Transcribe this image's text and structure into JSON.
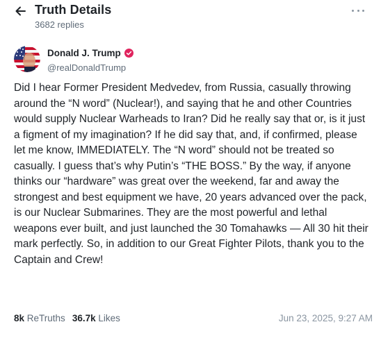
{
  "header": {
    "title": "Truth Details",
    "replies": "3682 replies"
  },
  "author": {
    "name": "Donald J. Trump",
    "handle": "@realDonaldTrump",
    "verified": true
  },
  "post": {
    "text": "Did I hear Former President Medvedev, from Russia, casually throwing around the “N word” (Nuclear!), and saying that he and other Countries would supply Nuclear Warheads to Iran? Did he really say that or, is it just a figment of my imagination? If he did say that, and, if confirmed, please let me know, IMMEDIATELY. The “N word” should not be treated so casually. I guess that’s why Putin’s “THE BOSS.” By the way, if anyone thinks our “hardware” was great over the weekend, far and away the strongest and best equipment we have, 20 years advanced over the pack, is our Nuclear Submarines. They are the most powerful and lethal weapons ever built, and just launched the 30 Tomahawks — All 30 hit their mark perfectly. So, in addition to our Great Fighter Pilots, thank you to the Captain and Crew!"
  },
  "stats": {
    "retruths_count": "8k",
    "retruths_label": "ReTruths",
    "likes_count": "36.7k",
    "likes_label": "Likes"
  },
  "timestamp": "Jun 23, 2025, 9:27 AM",
  "colors": {
    "text_primary": "#1f2328",
    "text_secondary": "#5f6b78",
    "verified_badge": "#e0245e"
  },
  "icons": {
    "back": "arrow-left-icon",
    "more": "more-horizontal-icon",
    "verified": "verified-badge-icon"
  }
}
